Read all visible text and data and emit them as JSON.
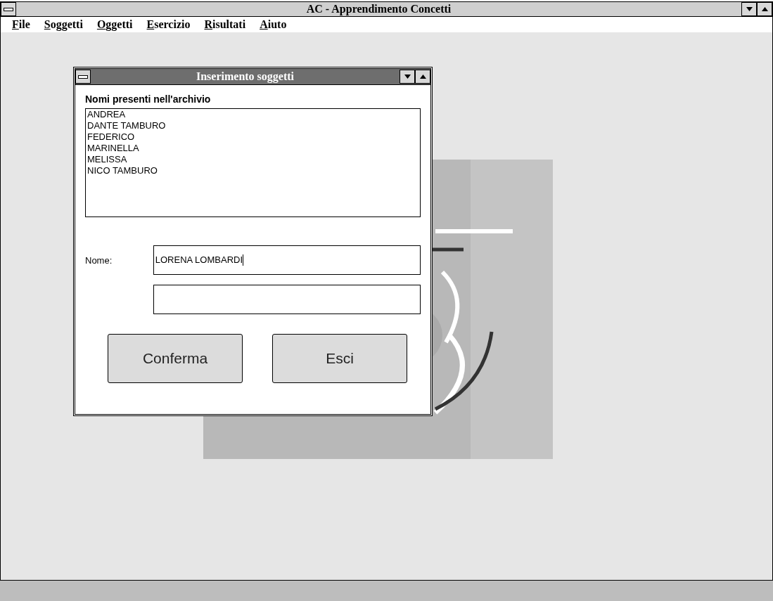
{
  "window": {
    "title": "AC - Apprendimento Concetti"
  },
  "menu": [
    {
      "label": "File"
    },
    {
      "label": "Soggetti"
    },
    {
      "label": "Oggetti"
    },
    {
      "label": "Esercizio"
    },
    {
      "label": "Risultati"
    },
    {
      "label": "Aiuto"
    }
  ],
  "dialog": {
    "title": "Inserimento soggetti",
    "active": true,
    "list_label": "Nomi presenti nell'archivio",
    "list_items": [
      "ANDREA",
      "DANTE TAMBURO",
      "FEDERICO",
      "MARINELLA",
      "MELISSA",
      "NICO TAMBURO"
    ],
    "fields": [
      {
        "label": "Nome:",
        "value": "LORENA LOMBARDI",
        "focused": true
      },
      {
        "focused": false
      }
    ],
    "buttons": [
      "Conferma",
      "Esci"
    ]
  }
}
